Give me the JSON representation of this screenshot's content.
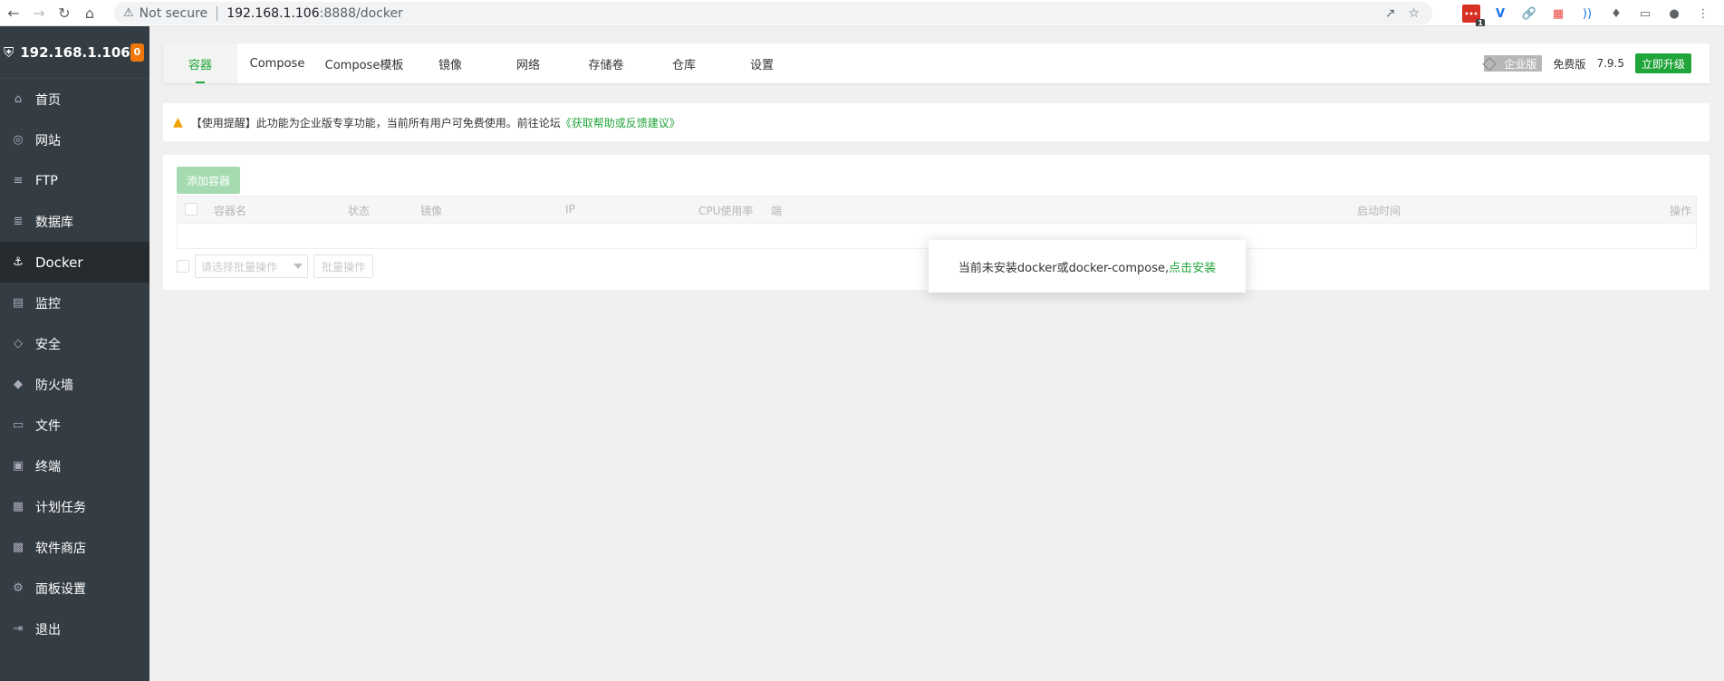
{
  "browser": {
    "not_secure": "Not secure",
    "url_host": "192.168.1.106",
    "url_path": ":8888/docker",
    "ext_badge_count": "1"
  },
  "sidebar": {
    "host_ip": "192.168.1.106",
    "alert_count": "0",
    "items": [
      {
        "label": "首页",
        "icon": "home-icon"
      },
      {
        "label": "网站",
        "icon": "globe-icon"
      },
      {
        "label": "FTP",
        "icon": "ftp-icon"
      },
      {
        "label": "数据库",
        "icon": "database-icon"
      },
      {
        "label": "Docker",
        "icon": "docker-icon"
      },
      {
        "label": "监控",
        "icon": "monitor-icon"
      },
      {
        "label": "安全",
        "icon": "shield-icon"
      },
      {
        "label": "防火墙",
        "icon": "firewall-icon"
      },
      {
        "label": "文件",
        "icon": "folder-icon"
      },
      {
        "label": "终端",
        "icon": "terminal-icon"
      },
      {
        "label": "计划任务",
        "icon": "calendar-icon"
      },
      {
        "label": "软件商店",
        "icon": "apps-icon"
      },
      {
        "label": "面板设置",
        "icon": "gear-icon"
      },
      {
        "label": "退出",
        "icon": "logout-icon"
      }
    ],
    "active_index": 4
  },
  "tabs": [
    {
      "label": "容器",
      "active": true
    },
    {
      "label": "Compose"
    },
    {
      "label": "Compose模板"
    },
    {
      "label": "镜像"
    },
    {
      "label": "网络"
    },
    {
      "label": "存储卷"
    },
    {
      "label": "仓库"
    },
    {
      "label": "设置"
    }
  ],
  "edition": {
    "enterprise": "企业版",
    "free": "免费版",
    "version": "7.9.5",
    "upgrade": "立即升级"
  },
  "notice": {
    "text": "【使用提醒】此功能为企业版专享功能，当前所有用户可免费使用。前往论坛",
    "link": "《获取帮助或反馈建议》"
  },
  "container_panel": {
    "add_button": "添加容器",
    "columns": [
      "容器名",
      "状态",
      "镜像",
      "IP",
      "CPU使用率",
      "端",
      "启动时间",
      "操作"
    ],
    "batch_placeholder": "请选择批量操作",
    "batch_button": "批量操作"
  },
  "popup": {
    "message": "当前未安装docker或docker-compose,",
    "install_link": "点击安装"
  },
  "colors": {
    "accent": "#20a53a",
    "sidebar_bg": "#353d44",
    "badge_orange": "#f0780a"
  }
}
